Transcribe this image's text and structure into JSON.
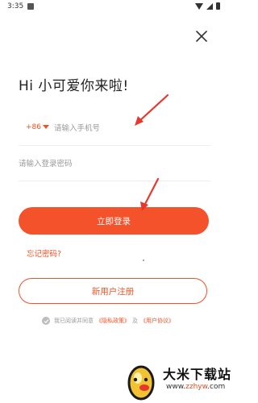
{
  "status_bar": {
    "time": "3:35"
  },
  "greeting": "Hi 小可爱你来啦!",
  "phone": {
    "country_code": "+86",
    "placeholder": "请输入手机号"
  },
  "password": {
    "placeholder": "请输入登录密码"
  },
  "login_button": "立即登录",
  "forgot_password": "忘记密码?",
  "register_button": "新用户注册",
  "agreement": {
    "prefix": "我已阅读并同意",
    "privacy": "《隐私政策》",
    "conjunction": "及",
    "terms": "《用户协议》"
  },
  "watermark": {
    "title": "大米下载站",
    "url_prefix": "www.",
    "url_domain": "zzhyw",
    "url_suffix": ".com"
  },
  "colors": {
    "accent": "#f4522a",
    "annotation_arrow": "#e8382e"
  },
  "icons": [
    "close-icon",
    "caret-down-icon",
    "check-icon",
    "wifi-icon",
    "signal-icon",
    "battery-icon"
  ]
}
